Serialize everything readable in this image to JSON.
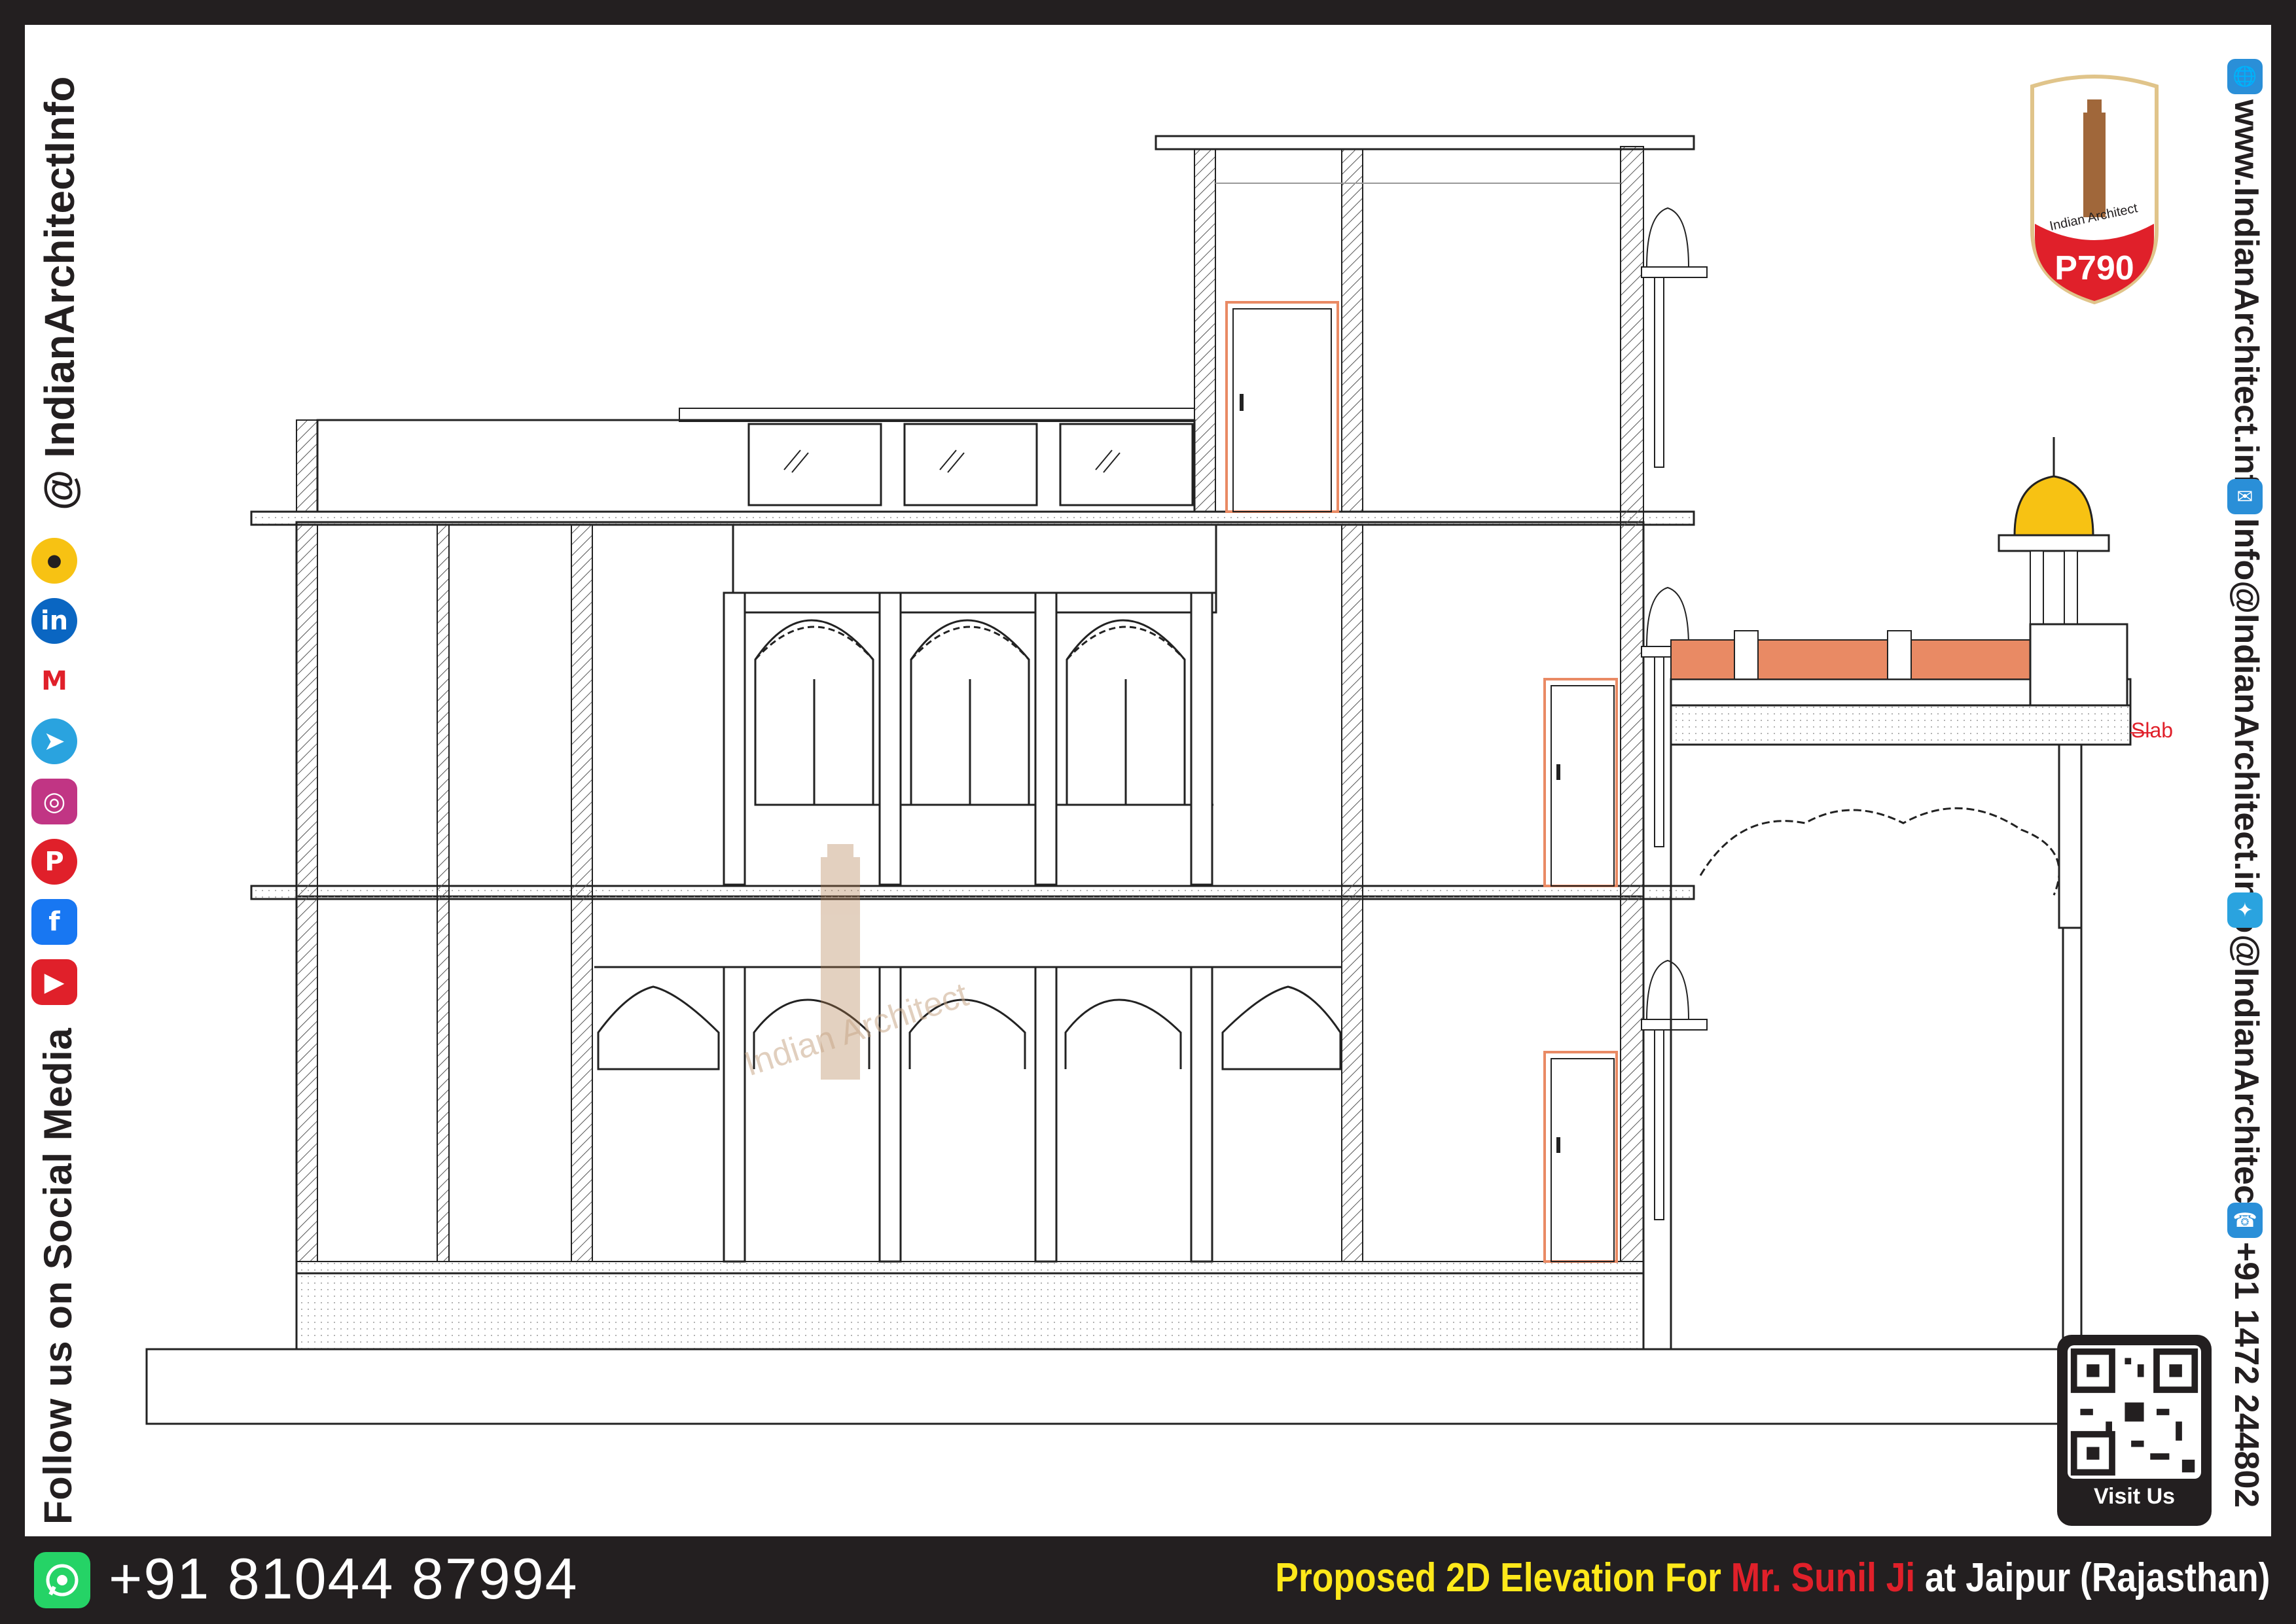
{
  "social_column": {
    "follow_text": "Follow us on Social Media",
    "handle": "@ IndianArchitectInfo",
    "icons": [
      "youtube-icon",
      "facebook-icon",
      "pinterest-icon",
      "instagram-icon",
      "telegram-icon",
      "moj-icon",
      "linkedin-icon",
      "koo-icon"
    ]
  },
  "contact_column": {
    "website": "www.IndianArchitect.info",
    "email": "Info@IndianArchitect.info",
    "twitter": "@IndianArchitec3",
    "phone": "+91 1472 244802"
  },
  "logo": {
    "text": "Indian Architect",
    "code": "P790"
  },
  "drawing": {
    "slab_label": "Slab",
    "watermark": "Indian Architect"
  },
  "qr": {
    "label": "Visit Us"
  },
  "footer": {
    "phone": "+91 81044 87994",
    "title_part1": "Proposed 2D Elevation For",
    "title_client": "Mr. Sunil Ji",
    "title_part2": "at Jaipur (Rajasthan)"
  },
  "colors": {
    "frame": "#231f20",
    "accent_red": "#e0202a",
    "title_yellow": "#ffe81a",
    "door_orange": "#e98a64",
    "dome_yellow": "#f7c213"
  }
}
